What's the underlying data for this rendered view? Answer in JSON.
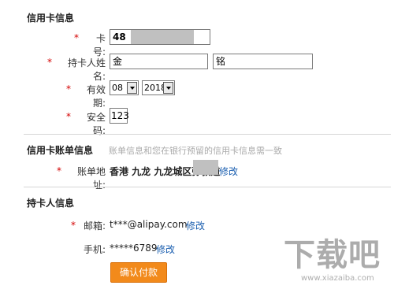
{
  "sections": {
    "credit_card": "信用卡信息",
    "billing": "信用卡账单信息",
    "billing_hint": "账单信息和您在银行预留的信用卡信息需一致",
    "cardholder": "持卡人信息"
  },
  "required_mark": "*",
  "card": {
    "number_label": "卡号:",
    "number_value": "48",
    "name_label": "持卡人姓名:",
    "surname_value": "金",
    "given_value": "铭",
    "expiry_label": "有效期:",
    "expiry_month": "08",
    "expiry_year": "2018",
    "cvv_label": "安全码:",
    "cvv_value": "123"
  },
  "billing": {
    "address_label": "账单地址:",
    "address_value": "香港 九龙 九龙城区弥敦道",
    "edit_link": "修改"
  },
  "holder": {
    "email_label": "邮箱:",
    "email_value": "t***@alipay.com",
    "email_edit": "修改",
    "phone_label": "手机:",
    "phone_value": "*****6789",
    "phone_edit": "修改"
  },
  "confirm_button": "确认付款",
  "watermark": {
    "logo_text": "下载吧",
    "url_text": "www.xiazaiba.com"
  }
}
